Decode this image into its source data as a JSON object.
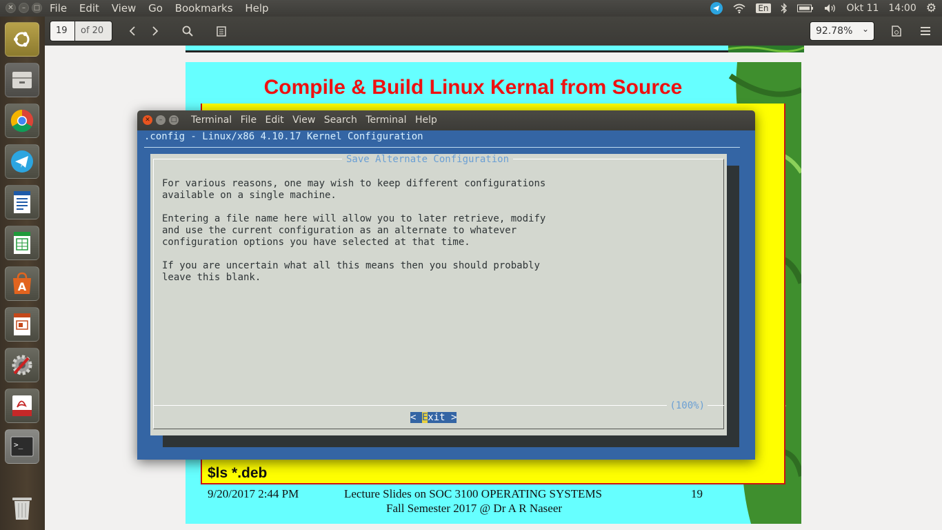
{
  "topbar": {
    "menus": [
      "File",
      "Edit",
      "View",
      "Go",
      "Bookmarks",
      "Help"
    ],
    "keyboard_layout": "En",
    "date": "Okt 11",
    "time": "14:00"
  },
  "launcher": {
    "items": [
      "ubuntu-logo-icon",
      "file-manager-icon",
      "chrome-icon",
      "telegram-icon",
      "writer-icon",
      "calc-icon",
      "software-center-icon",
      "impress-icon",
      "system-settings-icon",
      "document-viewer-icon",
      "terminal-icon",
      "trash-icon"
    ]
  },
  "viewer": {
    "page_number": "19",
    "page_count": "of 20",
    "zoom": "92.78%"
  },
  "slide": {
    "title": "Compile & Build Linux Kernal from Source",
    "command": "$ls  *.deb",
    "footer_date": "9/20/2017 2:44 PM",
    "footer_course": "Lecture Slides on SOC 3100 OPERATING SYSTEMS",
    "footer_page": "19",
    "footer_sub": "Fall Semester 2017 @ Dr A R Naseer"
  },
  "terminal": {
    "menu": [
      "Terminal",
      "File",
      "Edit",
      "View",
      "Search",
      "Terminal",
      "Help"
    ],
    "config_title": ".config - Linux/x86 4.10.17 Kernel Configuration",
    "dialog": {
      "title": "Save Alternate Configuration",
      "body": "For various reasons, one may wish to keep different configurations\navailable on a single machine.\n\nEntering a file name here will allow you to later retrieve, modify\nand use the current configuration as an alternate to whatever\nconfiguration options you have selected at that time.\n\nIf you are uncertain what all this means then you should probably\nleave this blank.",
      "progress": "(100%)",
      "exit_prefix": "< ",
      "exit_hotkey": "E",
      "exit_suffix": "xit >"
    }
  }
}
